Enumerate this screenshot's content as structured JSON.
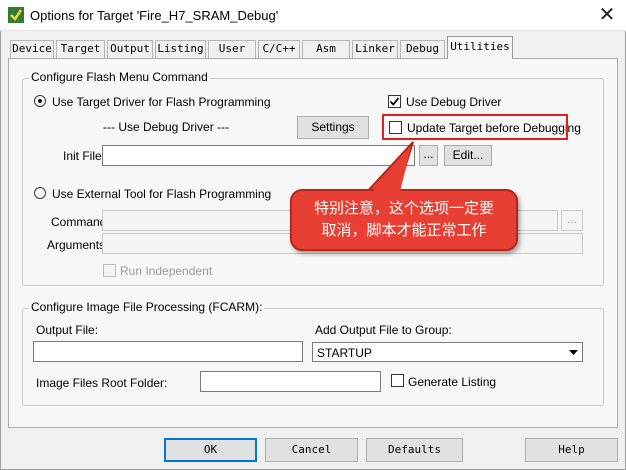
{
  "window": {
    "title": "Options for Target 'Fire_H7_SRAM_Debug'",
    "close_glyph": "✕"
  },
  "tabs": [
    {
      "label": "Device"
    },
    {
      "label": "Target"
    },
    {
      "label": "Output"
    },
    {
      "label": "Listing"
    },
    {
      "label": "User"
    },
    {
      "label": "C/C++"
    },
    {
      "label": "Asm"
    },
    {
      "label": "Linker"
    },
    {
      "label": "Debug"
    },
    {
      "label": "Utilities",
      "selected": true
    }
  ],
  "flash": {
    "group_title": "Configure Flash Menu Command",
    "use_target_driver": "Use Target Driver for Flash Programming",
    "use_debug_driver": "Use Debug Driver",
    "use_debug_driver_checked": true,
    "driver_placeholder": "--- Use Debug Driver ---",
    "settings_button": "Settings",
    "update_target": "Update Target before Debugging",
    "update_target_checked": false,
    "init_file_label": "Init File:",
    "init_file_value": "",
    "browse_button": "...",
    "edit_button": "Edit...",
    "use_external_tool": "Use External Tool for Flash Programming",
    "command_label": "Command:",
    "arguments_label": "Arguments:",
    "run_independent": "Run Independent"
  },
  "image": {
    "group_title": "Configure Image File Processing (FCARM):",
    "output_file_label": "Output File:",
    "output_file_value": "",
    "add_output_label": "Add Output File  to Group:",
    "group_select_value": "STARTUP",
    "root_folder_label": "Image Files Root Folder:",
    "root_folder_value": "",
    "generate_listing": "Generate Listing"
  },
  "buttons": {
    "ok": "OK",
    "cancel": "Cancel",
    "defaults": "Defaults",
    "help": "Help"
  },
  "callout": {
    "line1": "特别注意，这个选项一定要",
    "line2": "取消，脚本才能正常工作"
  },
  "colors": {
    "annotation_red": "#e0201b",
    "callout_fill": "#e73f34"
  }
}
